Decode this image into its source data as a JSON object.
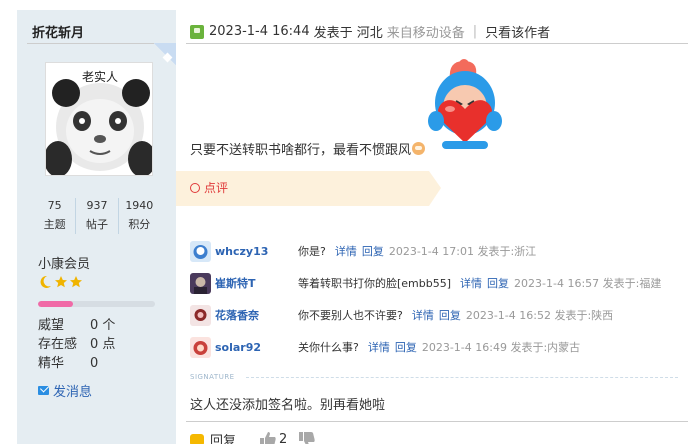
{
  "user": {
    "name": "折花斩月",
    "stats": [
      {
        "value": "75",
        "label": "主题"
      },
      {
        "value": "937",
        "label": "帖子"
      },
      {
        "value": "1940",
        "label": "积分"
      }
    ],
    "grade": "小康会员",
    "star_icons": [
      "moon-icon",
      "star-icon",
      "star-icon"
    ],
    "level_progress": 0.3,
    "props": [
      {
        "key": "威望",
        "value": "0 个"
      },
      {
        "key": "存在感",
        "value": "0 点"
      },
      {
        "key": "精华",
        "value": "0"
      }
    ],
    "send_message": "发消息",
    "avatar_caption": "老实人"
  },
  "post": {
    "datetime": "2023-1-4 16:44",
    "posted_in": "发表于 河北",
    "device": "来自移动设备",
    "separator": "|",
    "only_author": "只看该作者",
    "content": "只要不送转职书啥都行，最看不惯跟风",
    "rating_label": "点评",
    "comments": [
      {
        "user": "whczy13",
        "text": "你是?",
        "detail": "详情",
        "reply": "回复",
        "time": "2023-1-4 17:01 发表于:浙江",
        "avatar_color": "#3d7fcf"
      },
      {
        "user": "崔斯特T",
        "text": "等着转职书打你的脸[embb55]",
        "detail": "详情",
        "reply": "回复",
        "time": "2023-1-4 16:57 发表于:福建",
        "avatar_color": "#4a3a5c"
      },
      {
        "user": "花落香奈",
        "text": "你不要别人也不许要?",
        "detail": "详情",
        "reply": "回复",
        "time": "2023-1-4 16:52 发表于:陕西",
        "avatar_color": "#8b2a2a"
      },
      {
        "user": "solar92",
        "text": "关你什么事?",
        "detail": "详情",
        "reply": "回复",
        "time": "2023-1-4 16:49 发表于:内蒙古",
        "avatar_color": "#c9413b"
      }
    ],
    "signature_label": "SIGNATURE",
    "signature": "这人还没添加签名啦。别再看她啦",
    "reply": "回复",
    "likes": "2"
  },
  "colors": {
    "sidebar_bg": "#e5edf2",
    "link": "#2d64b3",
    "rating_bg": "#fdf1dc",
    "rating_text": "#e03a3a",
    "progress_fill": "#f06aa7"
  }
}
